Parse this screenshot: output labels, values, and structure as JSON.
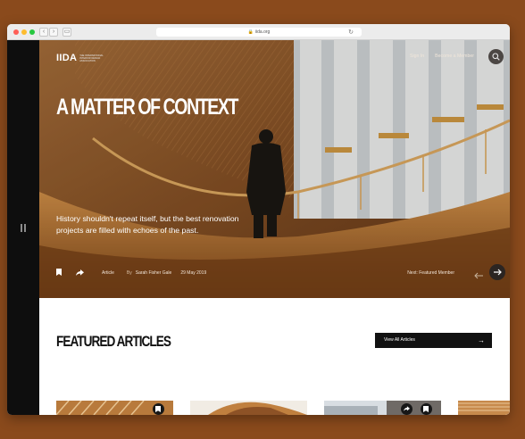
{
  "browser": {
    "url": "iida.org"
  },
  "site": {
    "logo": "IIDA",
    "logo_tagline": "The International Interior Design Association",
    "nav": [
      "Sign In",
      "Become a Member"
    ]
  },
  "hero": {
    "headline": "A MATTER OF CONTEXT",
    "dek": "History shouldn't repeat itself, but the best renovation projects are filled with echoes of the past.",
    "type": "Article",
    "by": "By",
    "author": "Sarah Fisher Gale",
    "date": "29 May 2019",
    "next_label": "Next: Featured Member"
  },
  "featured": {
    "title": "FEATURED ARTICLES",
    "view_all": "View All Articles"
  },
  "icons": {
    "bookmark": "bookmark-icon",
    "share": "share-icon",
    "search": "search-icon",
    "pause": "pause-icon",
    "arrow_left": "arrow-left-icon",
    "arrow_right": "arrow-right-icon"
  },
  "colors": {
    "page_background": "#8a4a1c",
    "rail": "#0e0e0e",
    "button_dark": "#111111"
  }
}
